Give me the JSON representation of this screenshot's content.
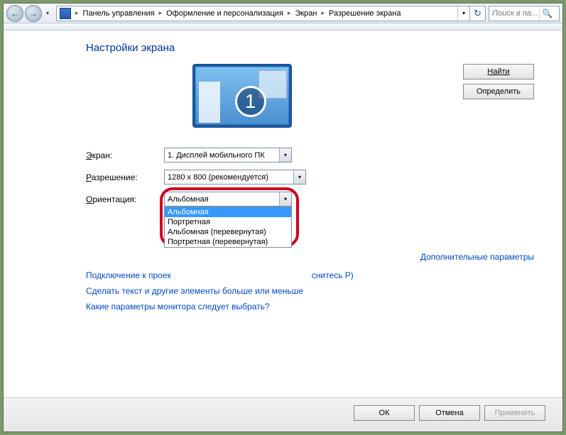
{
  "breadcrumb": {
    "seg1": "Панель управления",
    "seg2": "Оформление и персонализация",
    "seg3": "Экран",
    "seg4": "Разрешение экрана"
  },
  "search": {
    "placeholder": "Поиск в па..."
  },
  "title": "Настройки экрана",
  "buttons": {
    "find": "Найти",
    "detect": "Определить",
    "ok": "ОК",
    "cancel": "Отмена",
    "apply": "Применить"
  },
  "form": {
    "screen_label_pre": "Э",
    "screen_label_post": "кран:",
    "screen_value": "1. Дисплей мобильного ПК",
    "res_label_pre": "Р",
    "res_label_post": "азрешение:",
    "res_value": "1280 x 800 (рекомендуется)",
    "orient_label_pre": "О",
    "orient_label_post": "риентация:",
    "orient_value": "Альбомная",
    "orient_options": {
      "o1": "Альбомная",
      "o2": "Портретная",
      "o3": "Альбомная (перевернутая)",
      "o4": "Портретная (перевернутая)"
    }
  },
  "links": {
    "advanced": "Дополнительные параметры",
    "projector_pre": "Подключение к проек",
    "projector_post": "снитесь P)",
    "textsize": "Сделать текст и другие элементы больше или меньше",
    "which": "Какие параметры монитора следует выбрать?"
  },
  "monitor_number": "1"
}
